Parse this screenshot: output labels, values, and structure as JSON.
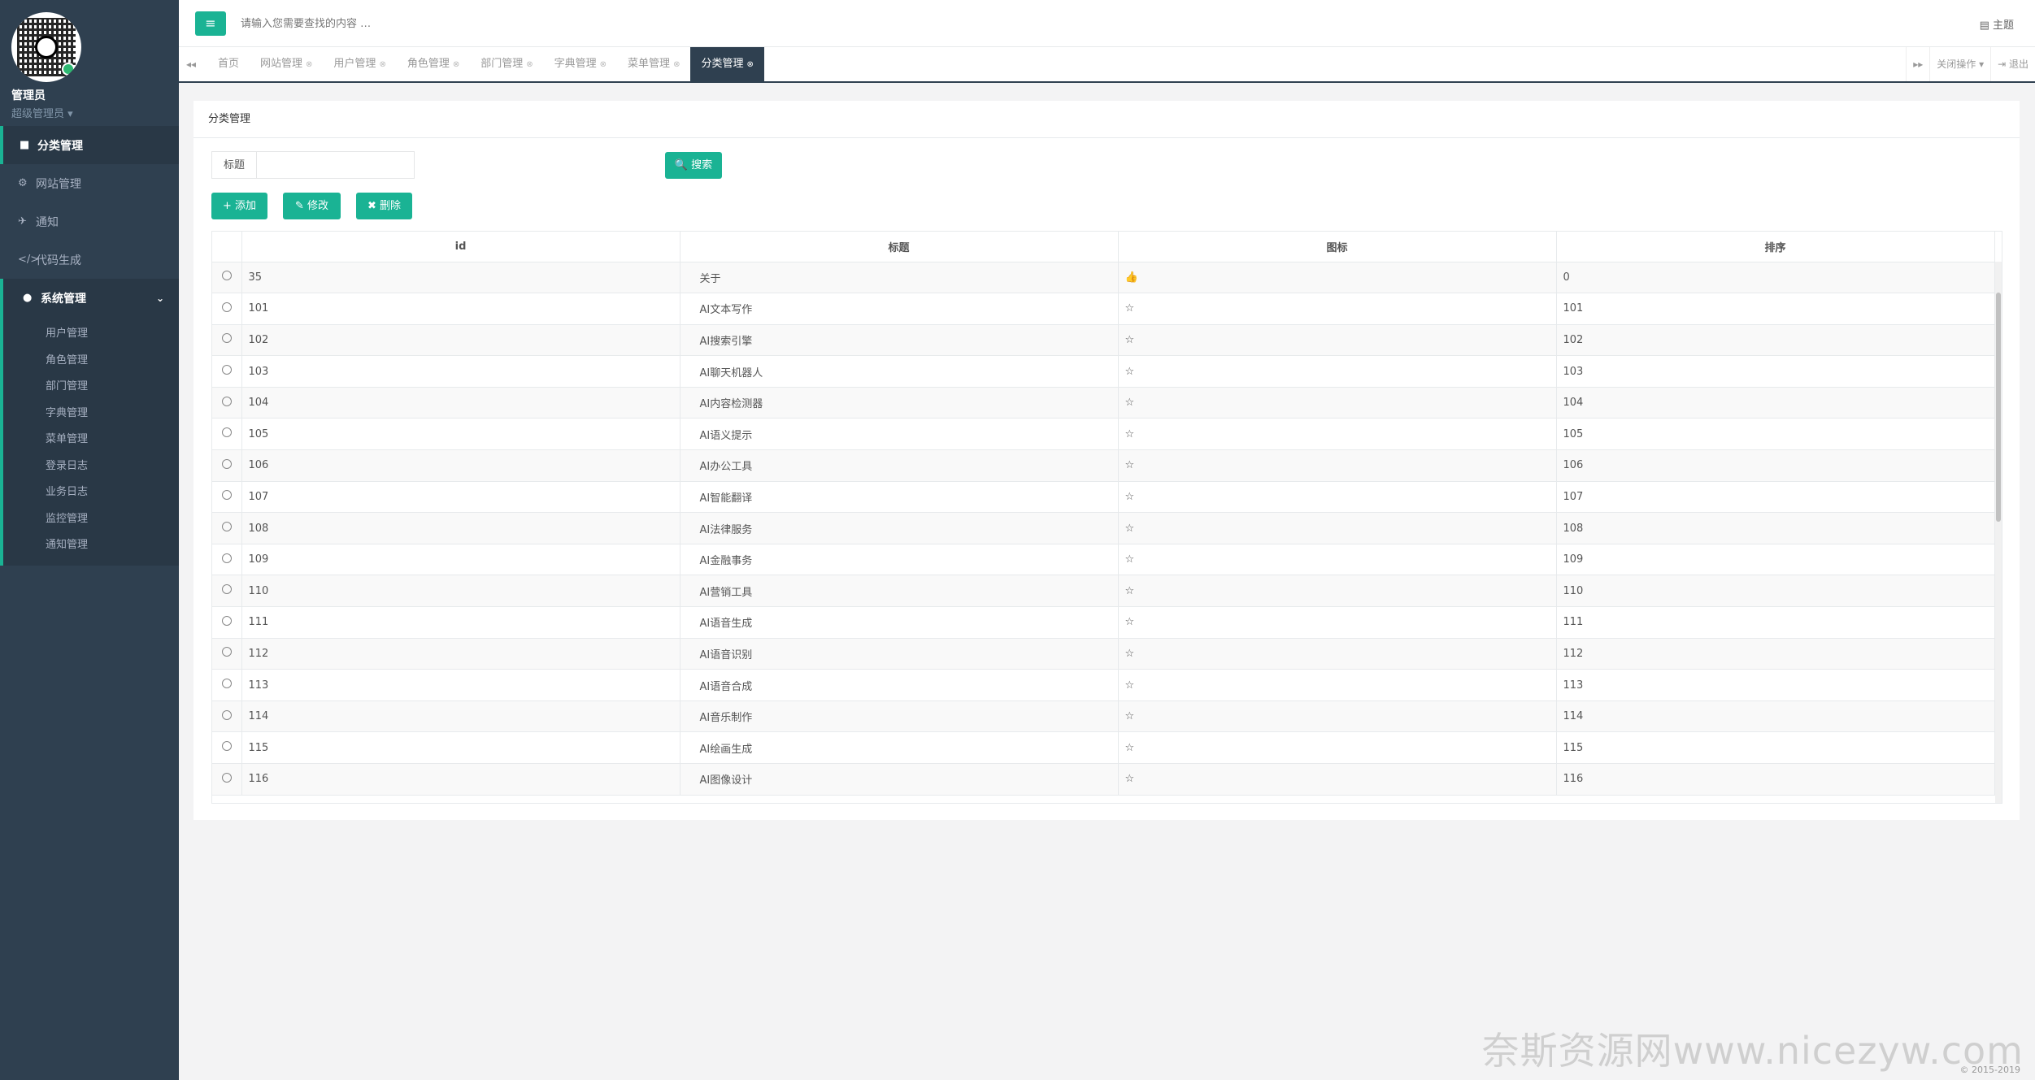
{
  "sidebar": {
    "user_name": "管理员",
    "user_role": "超级管理员 ▾",
    "items": [
      {
        "label": "分类管理",
        "icon": "■"
      },
      {
        "label": "网站管理",
        "icon": "⚙"
      },
      {
        "label": "通知",
        "icon": "✈"
      },
      {
        "label": "代码生成",
        "icon": "</>"
      }
    ],
    "system": {
      "label": "系统管理",
      "icon": "●",
      "caret": "⌄"
    },
    "sub_items": [
      "用户管理",
      "角色管理",
      "部门管理",
      "字典管理",
      "菜单管理",
      "登录日志",
      "业务日志",
      "监控管理",
      "通知管理"
    ]
  },
  "topbar": {
    "menu_icon": "≡",
    "search_placeholder": "请输入您需要查找的内容 …",
    "theme_label": "▤ 主题"
  },
  "tabs": {
    "prev": "◂◂",
    "next": "▸▸",
    "items": [
      {
        "label": "首页",
        "close": ""
      },
      {
        "label": "网站管理",
        "close": "⊗"
      },
      {
        "label": "用户管理",
        "close": "⊗"
      },
      {
        "label": "角色管理",
        "close": "⊗"
      },
      {
        "label": "部门管理",
        "close": "⊗"
      },
      {
        "label": "字典管理",
        "close": "⊗"
      },
      {
        "label": "菜单管理",
        "close": "⊗"
      },
      {
        "label": "分类管理",
        "close": "⊗"
      }
    ],
    "close_ops": "关闭操作 ▾",
    "logout": "⇥ 退出"
  },
  "panel": {
    "title": "分类管理",
    "filter_label": "标题",
    "search_btn": "🔍 搜索",
    "add_btn": "+ 添加",
    "edit_btn": "✎ 修改",
    "delete_btn": "✖ 删除"
  },
  "table": {
    "headers": [
      "id",
      "标题",
      "图标",
      "排序"
    ],
    "rows": [
      {
        "id": "35",
        "title": "关于",
        "icon": "👍",
        "sort": "0"
      },
      {
        "id": "101",
        "title": "AI文本写作",
        "icon": "☆",
        "sort": "101"
      },
      {
        "id": "102",
        "title": "AI搜索引擎",
        "icon": "☆",
        "sort": "102"
      },
      {
        "id": "103",
        "title": "AI聊天机器人",
        "icon": "☆",
        "sort": "103"
      },
      {
        "id": "104",
        "title": "AI内容检测器",
        "icon": "☆",
        "sort": "104"
      },
      {
        "id": "105",
        "title": "AI语义提示",
        "icon": "☆",
        "sort": "105"
      },
      {
        "id": "106",
        "title": "AI办公工具",
        "icon": "☆",
        "sort": "106"
      },
      {
        "id": "107",
        "title": "AI智能翻译",
        "icon": "☆",
        "sort": "107"
      },
      {
        "id": "108",
        "title": "AI法律服务",
        "icon": "☆",
        "sort": "108"
      },
      {
        "id": "109",
        "title": "AI金融事务",
        "icon": "☆",
        "sort": "109"
      },
      {
        "id": "110",
        "title": "AI营销工具",
        "icon": "☆",
        "sort": "110"
      },
      {
        "id": "111",
        "title": "AI语音生成",
        "icon": "☆",
        "sort": "111"
      },
      {
        "id": "112",
        "title": "AI语音识别",
        "icon": "☆",
        "sort": "112"
      },
      {
        "id": "113",
        "title": "AI语音合成",
        "icon": "☆",
        "sort": "113"
      },
      {
        "id": "114",
        "title": "AI音乐制作",
        "icon": "☆",
        "sort": "114"
      },
      {
        "id": "115",
        "title": "AI绘画生成",
        "icon": "☆",
        "sort": "115"
      },
      {
        "id": "116",
        "title": "AI图像设计",
        "icon": "☆",
        "sort": "116"
      }
    ]
  },
  "footer": "© 2015-2019",
  "watermark": "奈斯资源网www.nicezyw.com",
  "colors": {
    "accent": "#1ab394",
    "sidebar": "#2f4050"
  }
}
